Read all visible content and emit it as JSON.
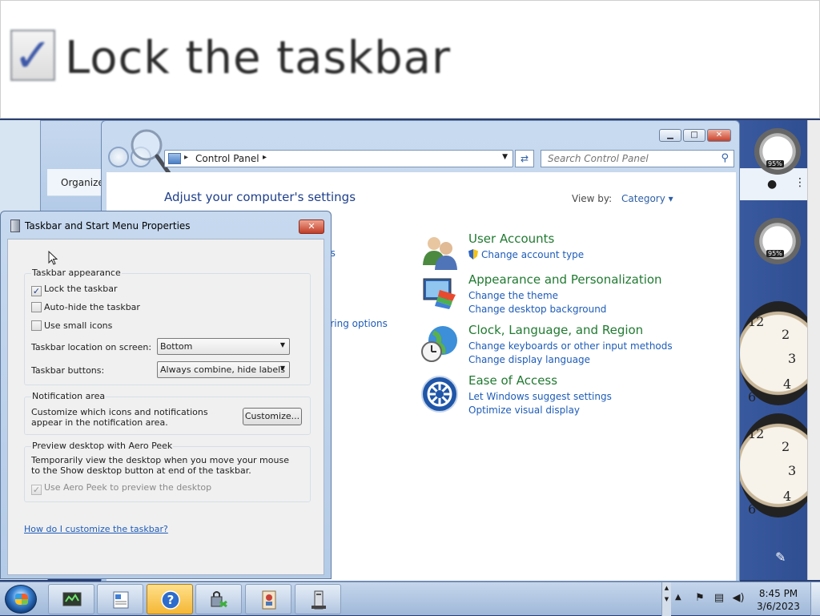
{
  "zoom_banner": {
    "label": "Lock the taskbar",
    "check": "✓"
  },
  "control_panel": {
    "address": {
      "segment": "Control Panel"
    },
    "search": {
      "placeholder": "Search Control Panel"
    },
    "heading": "Adjust your computer's settings",
    "view_by": {
      "label": "View by:",
      "value": "Category ▾"
    },
    "partial_links": [
      "us",
      "aring options"
    ],
    "categories": [
      {
        "title": "User Accounts",
        "links": [
          "Change account type"
        ],
        "icon": "users-icon"
      },
      {
        "title": "Appearance and Personalization",
        "links": [
          "Change the theme",
          "Change desktop background"
        ],
        "icon": "monitor-paint-icon"
      },
      {
        "title": "Clock, Language, and Region",
        "links": [
          "Change keyboards or other input methods",
          "Change display language"
        ],
        "icon": "globe-clock-icon"
      },
      {
        "title": "Ease of Access",
        "links": [
          "Let Windows suggest settings",
          "Optimize visual display"
        ],
        "icon": "ease-of-access-icon"
      }
    ]
  },
  "back_window": {
    "organize_label": "Organize"
  },
  "taskbar_dialog": {
    "title": "Taskbar and Start Menu Properties",
    "close": "✕",
    "appearance": {
      "title": "Taskbar appearance",
      "lock": {
        "label": "Lock the taskbar",
        "checked": true
      },
      "autohide": {
        "label": "Auto-hide the taskbar",
        "checked": false
      },
      "small_icons": {
        "label": "Use small icons",
        "checked": false
      },
      "location_label": "Taskbar location on screen:",
      "location_value": "Bottom",
      "buttons_label": "Taskbar buttons:",
      "buttons_value": "Always combine, hide labels"
    },
    "notification": {
      "title": "Notification area",
      "text": "Customize which icons and notifications appear in the notification area.",
      "customize_label": "Customize..."
    },
    "aero_peek": {
      "title": "Preview desktop with Aero Peek",
      "text": "Temporarily view the desktop when you move your mouse to the Show desktop button at end of the taskbar.",
      "checkbox_label": "Use Aero Peek to preview the desktop",
      "checked": true,
      "disabled": true
    },
    "help_link": "How do I customize the taskbar?"
  },
  "gadgets": {
    "meter_1": "95%",
    "meter_2": "95%",
    "clock_numbers": [
      "12",
      "2",
      "3",
      "4",
      "6"
    ]
  },
  "taskbar": {
    "time": "8:45 PM",
    "date": "3/6/2023",
    "buttons": [
      "screen-capture-icon",
      "document-icon",
      "help-icon",
      "network-lock-icon",
      "stamp-icon",
      "tower-icon"
    ]
  },
  "colors": {
    "link": "#1e5cb8",
    "category_title": "#217a31",
    "heading": "#1e3f8c"
  }
}
